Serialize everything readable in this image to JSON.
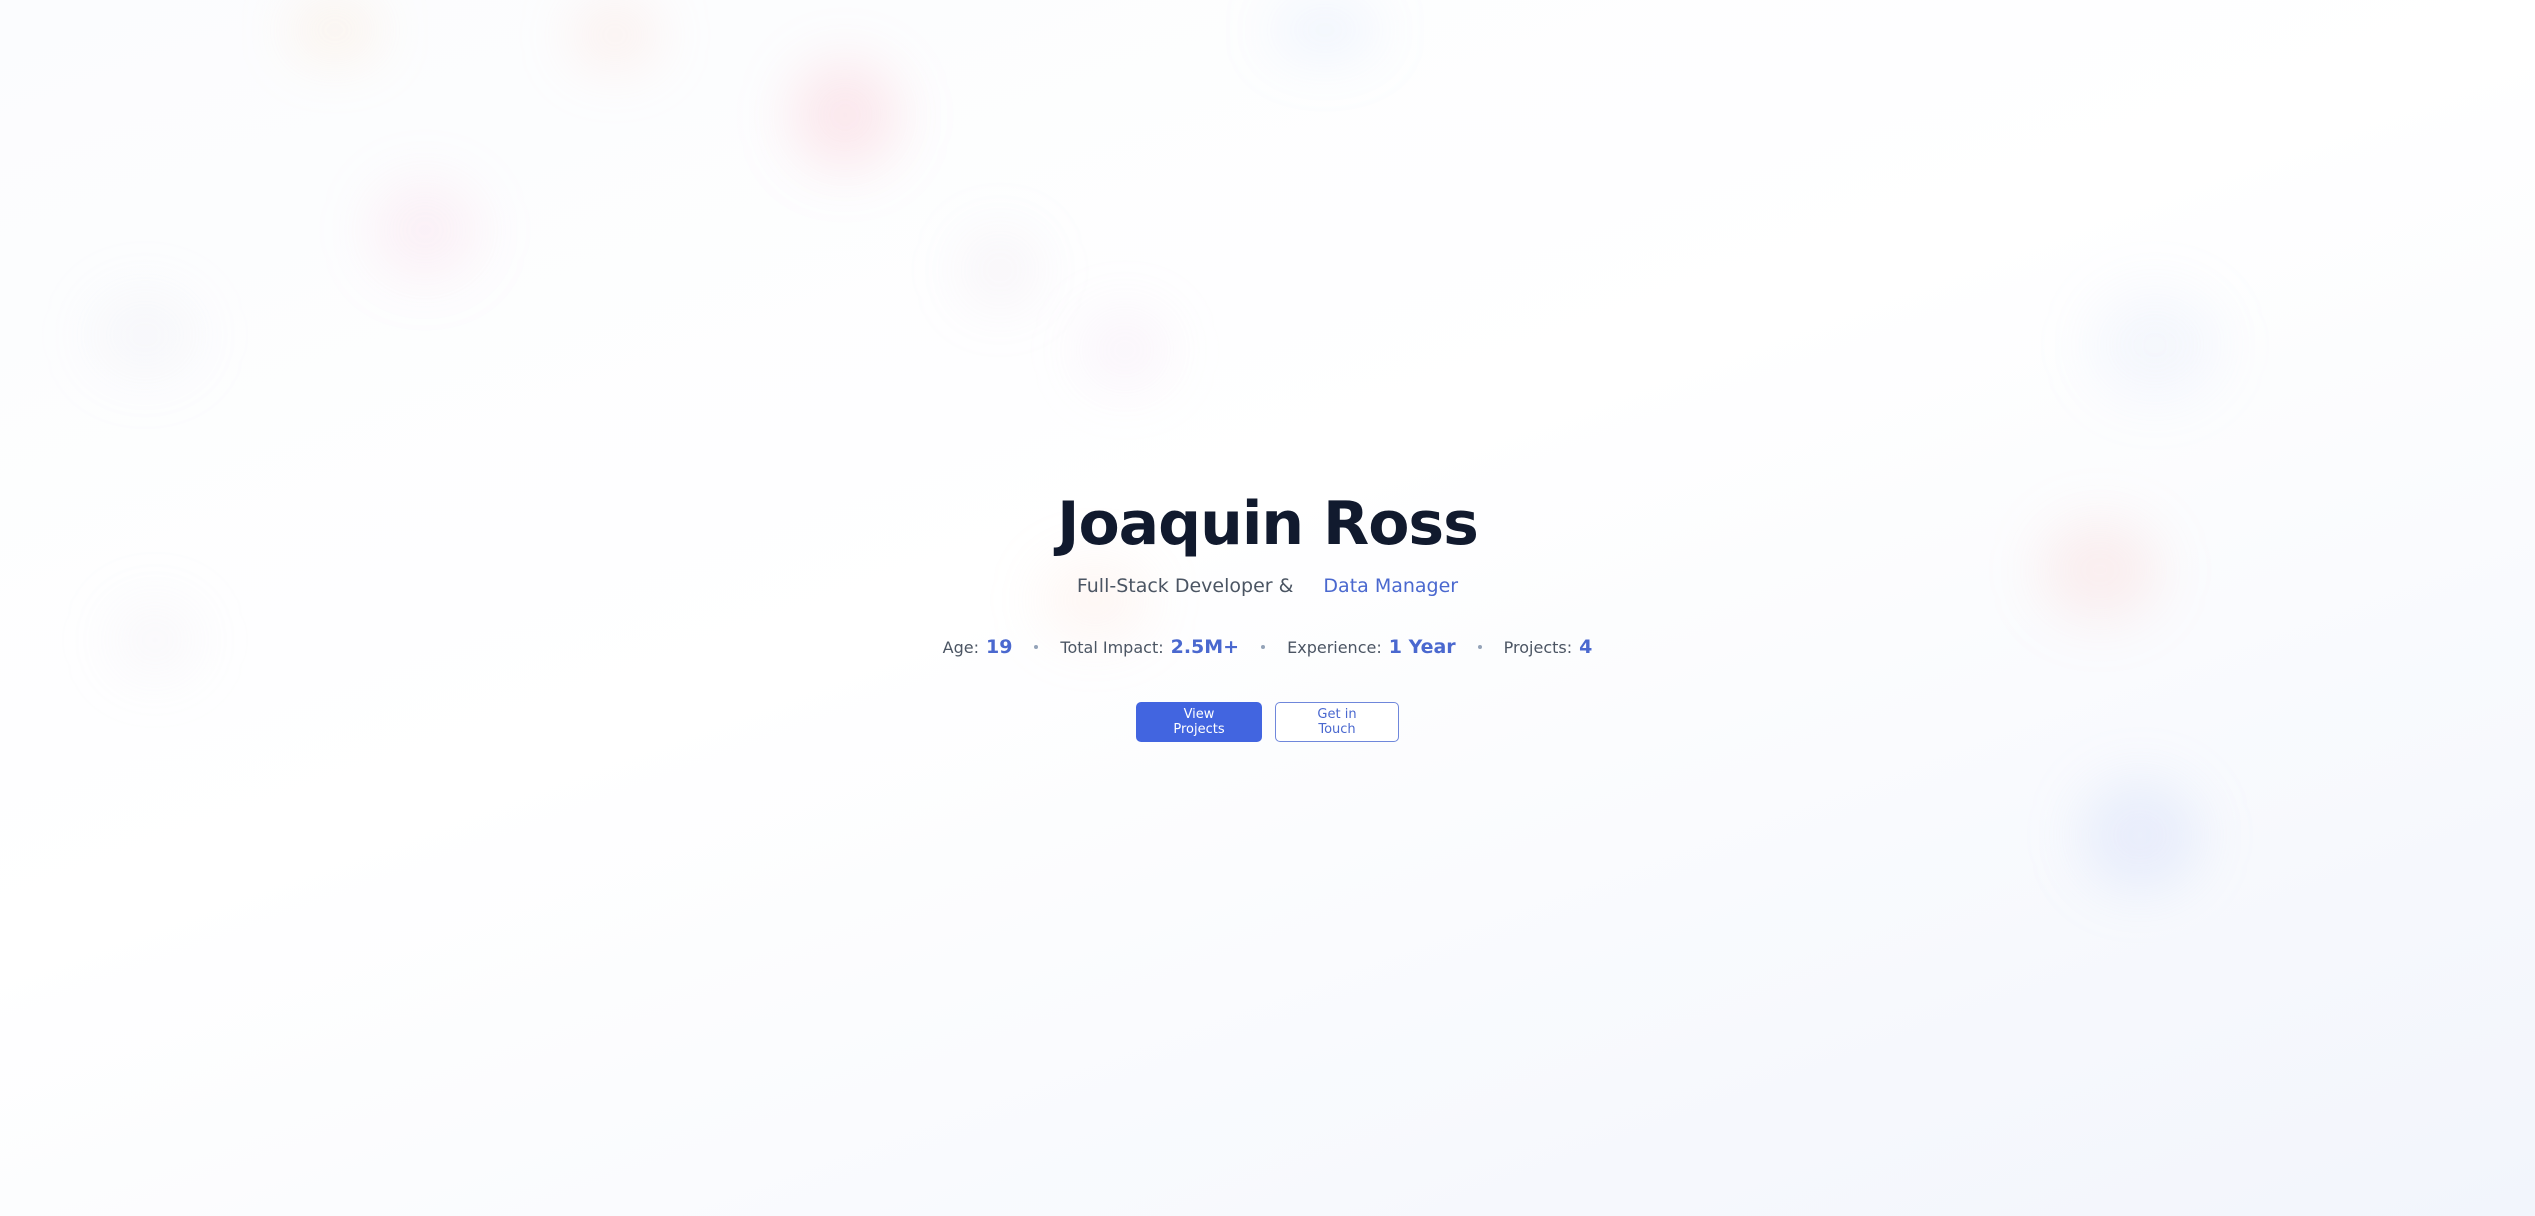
{
  "hero": {
    "name": "Joaquin Ross",
    "role_primary": "Full-Stack Developer &",
    "role_accent": "Data Manager"
  },
  "stats": [
    {
      "label": "Age:",
      "value": "19"
    },
    {
      "label": "Total Impact:",
      "value": "2.5M+"
    },
    {
      "label": "Experience:",
      "value": "1 Year"
    },
    {
      "label": "Projects:",
      "value": "4"
    }
  ],
  "actions": {
    "primary_label": "View Projects",
    "secondary_label": "Get in Touch"
  },
  "colors": {
    "accent": "#4a68cf",
    "primary_button": "#4265e0",
    "heading": "#111a2e",
    "muted_text": "#4b5563"
  }
}
